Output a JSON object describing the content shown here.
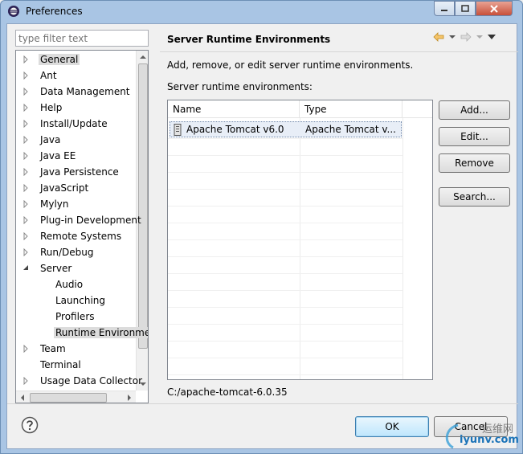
{
  "window": {
    "title": "Preferences"
  },
  "filter": {
    "placeholder": "type filter text"
  },
  "tree": {
    "items": [
      {
        "label": "General",
        "level": 0,
        "expandable": true,
        "expanded": false,
        "selected": true
      },
      {
        "label": "Ant",
        "level": 0,
        "expandable": true,
        "expanded": false
      },
      {
        "label": "Data Management",
        "level": 0,
        "expandable": true,
        "expanded": false
      },
      {
        "label": "Help",
        "level": 0,
        "expandable": true,
        "expanded": false
      },
      {
        "label": "Install/Update",
        "level": 0,
        "expandable": true,
        "expanded": false
      },
      {
        "label": "Java",
        "level": 0,
        "expandable": true,
        "expanded": false
      },
      {
        "label": "Java EE",
        "level": 0,
        "expandable": true,
        "expanded": false
      },
      {
        "label": "Java Persistence",
        "level": 0,
        "expandable": true,
        "expanded": false
      },
      {
        "label": "JavaScript",
        "level": 0,
        "expandable": true,
        "expanded": false
      },
      {
        "label": "Mylyn",
        "level": 0,
        "expandable": true,
        "expanded": false
      },
      {
        "label": "Plug-in Development",
        "level": 0,
        "expandable": true,
        "expanded": false
      },
      {
        "label": "Remote Systems",
        "level": 0,
        "expandable": true,
        "expanded": false
      },
      {
        "label": "Run/Debug",
        "level": 0,
        "expandable": true,
        "expanded": false
      },
      {
        "label": "Server",
        "level": 0,
        "expandable": true,
        "expanded": true
      },
      {
        "label": "Audio",
        "level": 1,
        "expandable": false
      },
      {
        "label": "Launching",
        "level": 1,
        "expandable": false
      },
      {
        "label": "Profilers",
        "level": 1,
        "expandable": false
      },
      {
        "label": "Runtime Environme",
        "level": 1,
        "expandable": false,
        "highlighted": true
      },
      {
        "label": "Team",
        "level": 0,
        "expandable": true,
        "expanded": false
      },
      {
        "label": "Terminal",
        "level": 0,
        "expandable": false
      },
      {
        "label": "Usage Data Collector",
        "level": 0,
        "expandable": true,
        "expanded": false
      }
    ]
  },
  "page": {
    "title": "Server Runtime Environments",
    "description": "Add, remove, or edit server runtime environments.",
    "list_label": "Server runtime environments:",
    "columns": [
      "Name",
      "Type"
    ],
    "rows": [
      {
        "name": "Apache Tomcat v6.0",
        "type": "Apache Tomcat v..."
      }
    ],
    "location": "C:/apache-tomcat-6.0.35"
  },
  "buttons": {
    "add": "Add...",
    "edit": "Edit...",
    "remove": "Remove",
    "search": "Search...",
    "ok": "OK",
    "cancel": "Cancel"
  },
  "watermark": {
    "line1": "运维网",
    "line2": "iyunv.com"
  },
  "colors": {
    "titlebar": "#a9c5e4",
    "selection": "#dcdcdc",
    "ok_border": "#3c7fb1"
  }
}
